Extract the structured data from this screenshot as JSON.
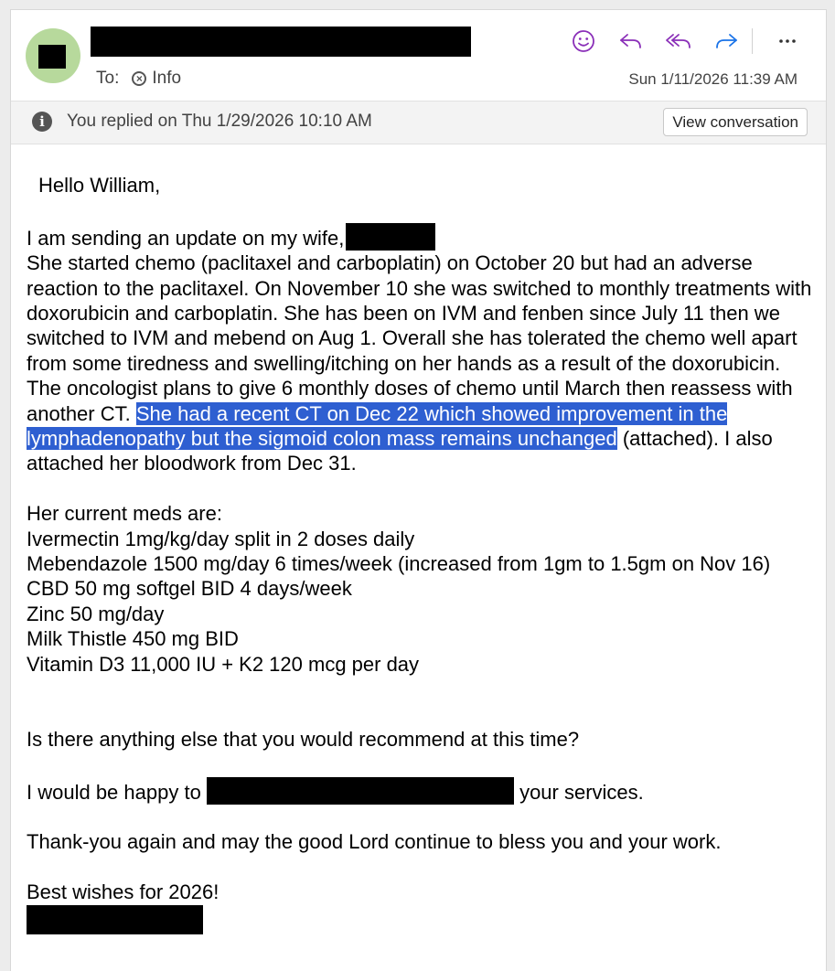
{
  "header": {
    "to_label": "To:",
    "recipient": "Info",
    "date": "Sun 1/11/2026 11:39 AM",
    "actions": [
      {
        "icon": "emoji-smile-icon",
        "label": "React"
      },
      {
        "icon": "reply-icon",
        "label": "Reply"
      },
      {
        "icon": "reply-all-icon",
        "label": "Reply all"
      },
      {
        "icon": "forward-icon",
        "label": "Forward"
      },
      {
        "icon": "more-icon",
        "label": "More"
      }
    ],
    "colors": {
      "emoji": "#8a2fb8",
      "reply": "#8a2fb8",
      "forward": "#1a73e8",
      "avatar": "#b7d99c"
    }
  },
  "banner": {
    "text": "You replied on Thu 1/29/2026 10:10 AM",
    "button_label": "View conversation"
  },
  "email": {
    "greeting": "Hello William,",
    "p1_line1": "I am sending an update on my wife,",
    "p1_text_a": "She started chemo (paclitaxel and carboplatin) on October 20 but had an adverse reaction to the paclitaxel. On November 10 she was switched to monthly treatments with doxorubicin and carboplatin. She has been on IVM and fenben since July 11 then we switched to IVM and mebend on Aug 1. Overall she has tolerated the chemo well apart from some tiredness and swelling/itching on her hands as a result of the doxorubicin. The oncologist plans to give 6 monthly doses of chemo until March then reassess with another CT. ",
    "p1_highlight": "She had a recent CT on Dec 22 which showed improvement in the lymphadenopathy but the sigmoid colon mass remains unchanged",
    "p1_text_b": " (attached). I also attached her bloodwork from Dec 31.",
    "meds_heading": "Her current meds are:",
    "meds": [
      "Ivermectin 1mg/kg/day split in 2 doses daily",
      "Mebendazole 1500 mg/day  6 times/week  (increased from 1gm to 1.5gm on Nov 16)",
      "CBD 50 mg softgel BID 4 days/week",
      "Zinc 50 mg/day",
      "Milk Thistle 450 mg BID",
      "Vitamin D3 11,000 IU + K2 120 mcg per day"
    ],
    "question": "Is there anything else that you would recommend at this time?",
    "happy_a": "I would be happy to",
    "happy_b": "your services.",
    "thanks": "Thank-you again and may the good Lord continue to bless you and your work.",
    "closing": "Best wishes for 2026!",
    "highlight_color": "#2e5fd1"
  }
}
